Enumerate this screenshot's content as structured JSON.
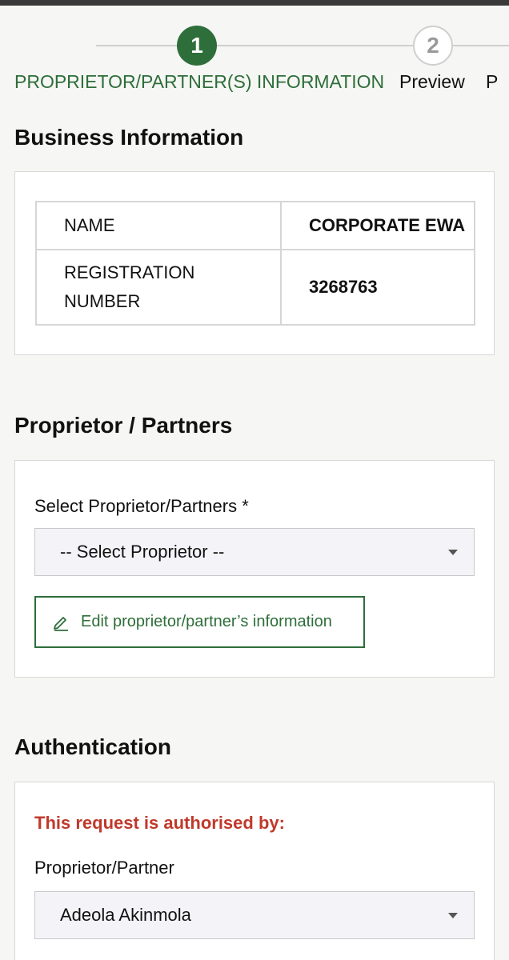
{
  "stepper": {
    "step1_number": "1",
    "step1_label": "PROPRIETOR/PARTNER(S) INFORMATION",
    "step2_number": "2",
    "step2_label": "Preview",
    "step3_label": "P"
  },
  "business": {
    "title": "Business Information",
    "rows": [
      {
        "label": "NAME",
        "value": "CORPORATE EWA"
      },
      {
        "label": "REGISTRATION NUMBER",
        "value": "3268763"
      }
    ]
  },
  "partners": {
    "title": "Proprietor / Partners",
    "select_label": "Select Proprietor/Partners *",
    "select_value": "-- Select Proprietor --",
    "edit_button": "Edit proprietor/partner’s information"
  },
  "authentication": {
    "title": "Authentication",
    "note": "This request is authorised by:",
    "field_label": "Proprietor/Partner",
    "field_value": "Adeola Akinmola"
  },
  "colors": {
    "brand_green": "#2e6e3a",
    "alert_red": "#c0392b"
  },
  "icons": [
    "pencil-icon",
    "caret-down-icon"
  ]
}
